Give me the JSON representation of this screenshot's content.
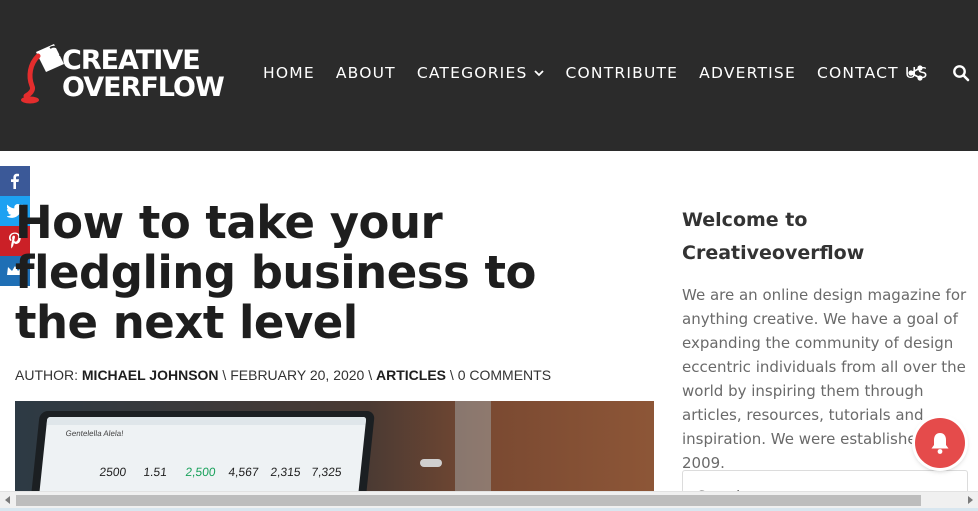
{
  "header": {
    "logo": {
      "line1": "CREATIVE",
      "line2": "OVERFLOW"
    },
    "nav": [
      {
        "label": "HOME"
      },
      {
        "label": "ABOUT"
      },
      {
        "label": "CATEGORIES",
        "has_dropdown": true
      },
      {
        "label": "CONTRIBUTE"
      },
      {
        "label": "ADVERTISE"
      },
      {
        "label": "CONTACT US"
      }
    ],
    "icons": [
      "share-icon",
      "search-icon"
    ],
    "background": "#2b2b2b"
  },
  "social": [
    {
      "icon": "facebook-icon",
      "color": "#3b5998"
    },
    {
      "icon": "twitter-icon",
      "color": "#1da1f2"
    },
    {
      "icon": "pinterest-icon",
      "color": "#cb2027"
    },
    {
      "icon": "sumo-crown-icon",
      "color": "#1f6fb5"
    }
  ],
  "article": {
    "title": "How to take your fledgling business to the next level",
    "meta": {
      "author_prefix": "AUTHOR: ",
      "author": "MICHAEL JOHNSON",
      "sep1": " \\ ",
      "date": "FEBRUARY 20, 2020",
      "sep2": " \\ ",
      "category": "ARTICLES",
      "sep3": " \\ ",
      "comments": "0 COMMENTS"
    },
    "hero_image": {
      "screen_name": "Gentelella Alela!",
      "stats": [
        "2500",
        "1.51",
        "2,500",
        "4,567",
        "2,315",
        "7,325"
      ]
    }
  },
  "sidebar": {
    "title": "Welcome to Creativeoverflow",
    "text": "We are an online design magazine for anything creative. We have a goal of expanding the community of design eccentric individuals from all over the world by inspiring them through articles, resources, tutorials and inspiration. We were established in 2009.",
    "search_value": "Search"
  },
  "notification_bell": {
    "icon": "bell-icon",
    "color": "#e54b4b"
  }
}
